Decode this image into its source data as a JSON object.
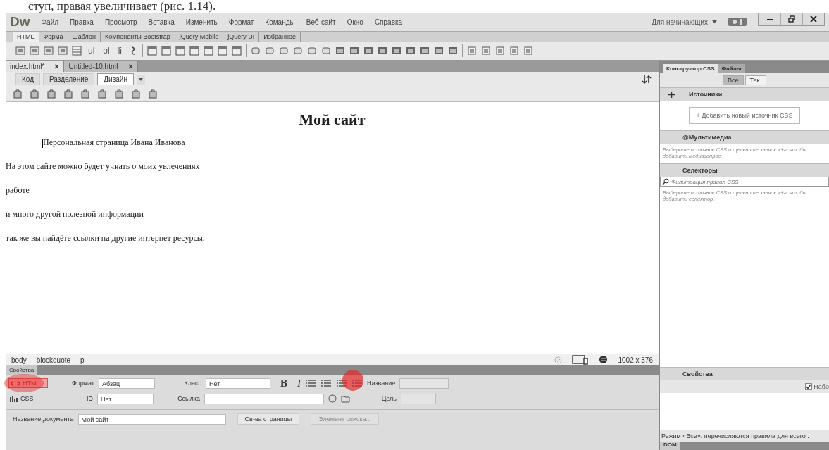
{
  "caption": "ступ, правая увеличивает (рис. 1.14).",
  "app": {
    "logo": "Dw",
    "menu": [
      "Файл",
      "Правка",
      "Просмотр",
      "Вставка",
      "Изменить",
      "Формат",
      "Команды",
      "Веб-сайт",
      "Окно",
      "Справка"
    ],
    "workspace": "Для начинающих"
  },
  "insert_tabs": [
    {
      "label": "HTML",
      "selected": true
    },
    {
      "label": "Форма",
      "selected": false
    },
    {
      "label": "Шаблон",
      "selected": false
    },
    {
      "label": "Компоненты Bootstrap",
      "selected": false
    },
    {
      "label": "jQuery Mobile",
      "selected": false
    },
    {
      "label": "jQuery UI",
      "selected": false
    },
    {
      "label": "Избранное",
      "selected": false
    }
  ],
  "insert_toolbar_text": [
    "ul",
    "ol",
    "li"
  ],
  "doc_tabs": [
    {
      "label": "index.html*",
      "selected": true
    },
    {
      "label": "Untitled-10.html",
      "selected": false
    }
  ],
  "view_buttons": [
    {
      "label": "Код",
      "selected": false
    },
    {
      "label": "Разделение",
      "selected": false
    },
    {
      "label": "Дизайн",
      "selected": true
    }
  ],
  "design": {
    "heading": "Мой сайт",
    "paragraphs": [
      {
        "kind": "indented",
        "text": "Персональная страница Ивана Иванова"
      },
      {
        "kind": "plain",
        "text": "На этом сайте можно будет учнать о моих увлечениях"
      },
      {
        "kind": "plain",
        "text": "работе"
      },
      {
        "kind": "plain",
        "text": "и много другой полезной информации"
      },
      {
        "kind": "plain",
        "text": "так же вы найдёте ссылки на другие интернет ресурсы."
      }
    ]
  },
  "tag_selector": [
    "body",
    "blockquote",
    "p"
  ],
  "status_size": "1002 x 376",
  "properties": {
    "tab": "Свойства",
    "modes": [
      {
        "label": "HTML",
        "selected": true
      },
      {
        "label": "CSS",
        "selected": false
      }
    ],
    "format_label": "Формат",
    "format_value": "Абзац",
    "class_label": "Класс",
    "class_value": "Нет",
    "bold": "B",
    "italic": "I",
    "title_label": "Название",
    "id_label": "ID",
    "id_value": "Нет",
    "link_label": "Ссылка",
    "target_label": "Цель",
    "doc_title_label": "Название документа",
    "doc_title_value": "Мой сайт",
    "page_props": "Св-ва страницы",
    "list_item": "Элемент списка...",
    "list_item_disabled": true
  },
  "css_panel": {
    "tabs": [
      {
        "label": "Конструктор CSS",
        "selected": true
      },
      {
        "label": "Файлы",
        "selected": false
      }
    ],
    "filter": [
      {
        "label": "Все",
        "selected": true
      },
      {
        "label": "Тек.",
        "selected": false
      }
    ],
    "sources_title": "Источники",
    "add_source": "+ Добавить новый источник CSS",
    "media_title": "@Мультимедиа",
    "media_hint": "Выберите источник CSS и щелкните значок «+», чтобы добавить медиазапрос.",
    "selectors_title": "Селекторы",
    "selectors_placeholder": "Фильтрация правил CSS",
    "selectors_hint": "Выберите источник CSS и щелкните значок «+», чтобы добавить селектор.",
    "properties_title": "Свойства",
    "show_set": {
      "label": "Набо",
      "checked": true
    },
    "mode_note": "Режим «Все»: перечисляются правила для всего .",
    "dom_tab": "DOM"
  }
}
